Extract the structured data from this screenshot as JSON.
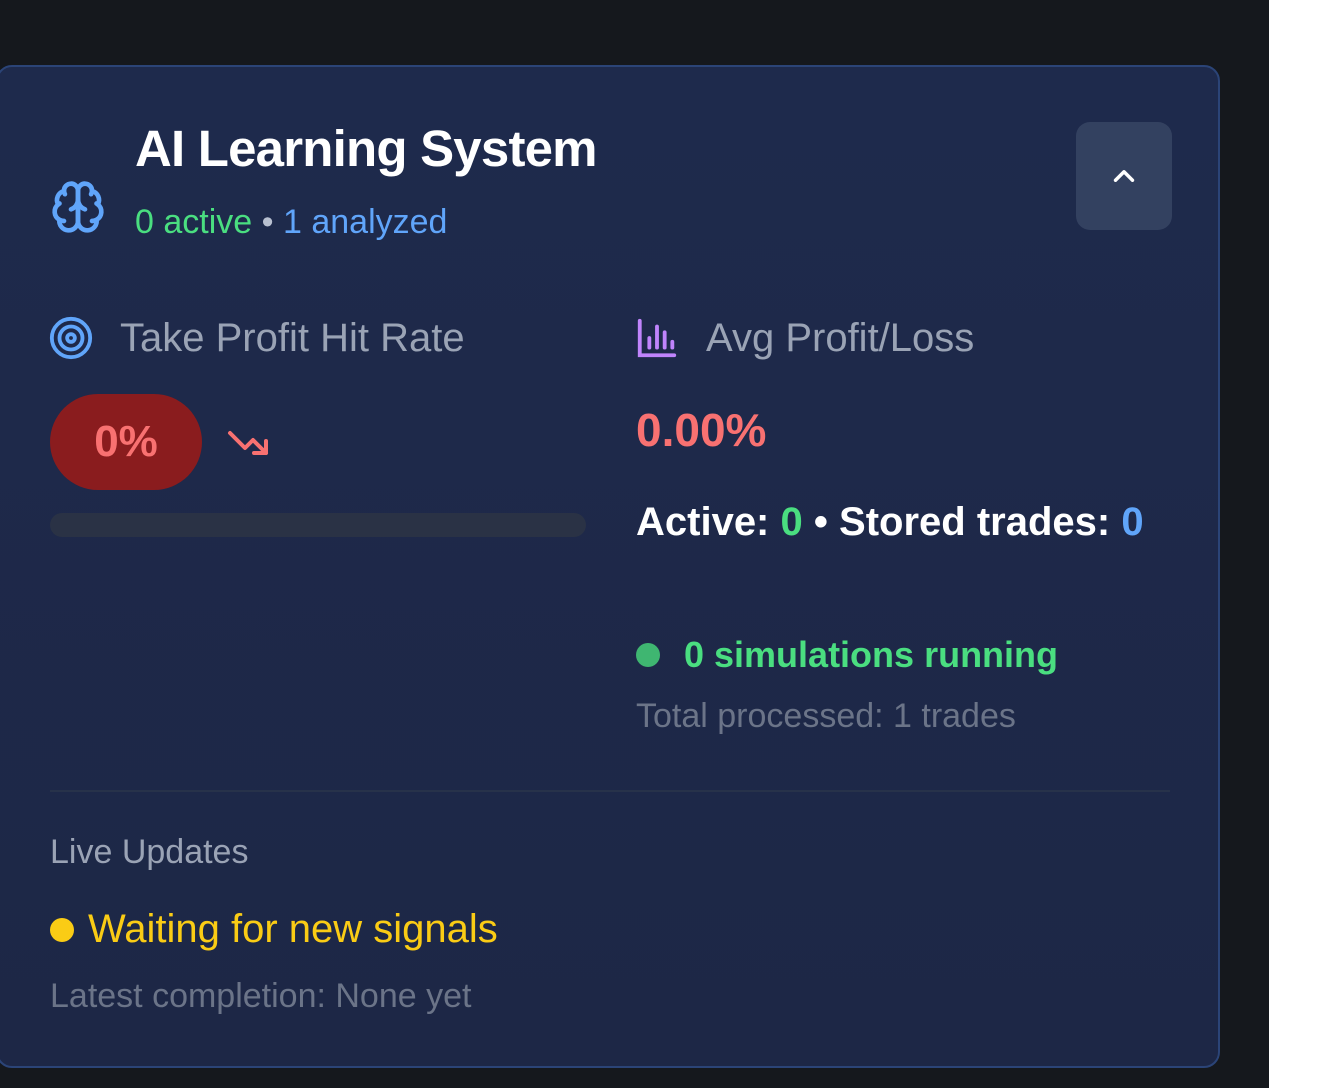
{
  "header": {
    "icon": "brain-icon",
    "title": "AI Learning System",
    "active_text": "0 active",
    "separator": "•",
    "analyzed_text": "1 analyzed",
    "collapse_icon": "chevron-up-icon"
  },
  "take_profit": {
    "icon": "target-icon",
    "label": "Take Profit Hit Rate",
    "value": "0%",
    "trend_icon": "trending-down-icon",
    "progress_percent": 0
  },
  "avg_profit": {
    "icon": "bar-chart-icon",
    "label": "Avg Profit/Loss",
    "value": "0.00%",
    "active_label": "Active:",
    "active_value": "0",
    "separator": "•",
    "stored_label": "Stored trades:",
    "stored_value": "0",
    "simulations_text": "0 simulations running",
    "total_processed": "Total processed: 1 trades"
  },
  "live_updates": {
    "label": "Live Updates",
    "status_text": "Waiting for new signals",
    "latest_completion": "Latest completion: None yet"
  },
  "colors": {
    "background": "#15181d",
    "card": "#1e2a4c",
    "card_border": "#2b4477",
    "green": "#4ade80",
    "blue": "#60a5fa",
    "red": "#f87171",
    "red_pill": "#8a1c1e",
    "yellow": "#facc15",
    "muted": "#9aa3b5"
  }
}
